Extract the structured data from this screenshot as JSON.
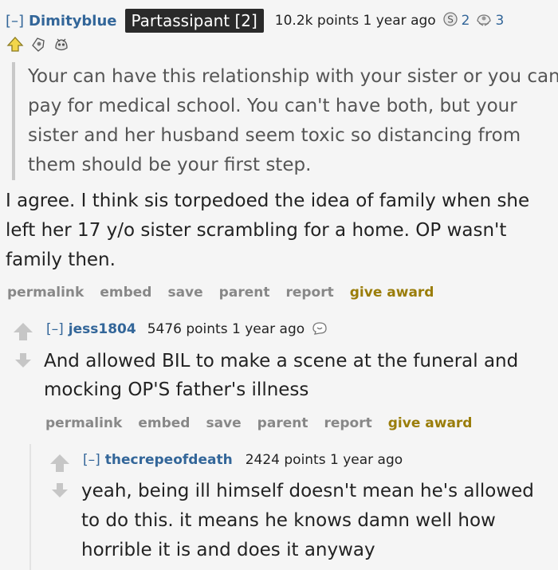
{
  "comment1": {
    "toggle": "[–]",
    "author": "Dimityblue",
    "flair": "Partassipant [2]",
    "score_time": "10.2k points 1 year ago",
    "award_counts": [
      "2",
      "3"
    ],
    "quote": "Your can have this relationship with your sister or you can pay for medical school. You can't have both, but your sister and her husband seem toxic so distancing from them should be your first step.",
    "body": "I agree. I think sis torpedoed the idea of family when she left her 17 y/o sister scrambling for a home. OP wasn't family then.",
    "buttons": {
      "permalink": "permalink",
      "embed": "embed",
      "save": "save",
      "parent": "parent",
      "report": "report",
      "award": "give award"
    }
  },
  "comment2": {
    "toggle": "[–]",
    "author": "jess1804",
    "score_time": "5476 points 1 year ago",
    "body": "And allowed BIL to make a scene at the funeral and mocking OP'S father's illness",
    "buttons": {
      "permalink": "permalink",
      "embed": "embed",
      "save": "save",
      "parent": "parent",
      "report": "report",
      "award": "give award"
    }
  },
  "comment3": {
    "toggle": "[–]",
    "author": "thecrepeofdeath",
    "score_time": "2424 points 1 year ago",
    "body": "yeah, being ill himself doesn't mean he's allowed to do this. it means he knows damn well how horrible it is and does it anyway"
  },
  "colors": {
    "author": "#336699",
    "award_button": "#9a7d0a",
    "buttons": "#888888",
    "flair_bg": "#2a2a2a",
    "upvote": "#c6c6c6"
  },
  "icons": [
    "silver-award-icon",
    "helpful-award-icon",
    "wholesome-award-icon",
    "upvote-arrow-icon",
    "downvote-arrow-icon"
  ]
}
